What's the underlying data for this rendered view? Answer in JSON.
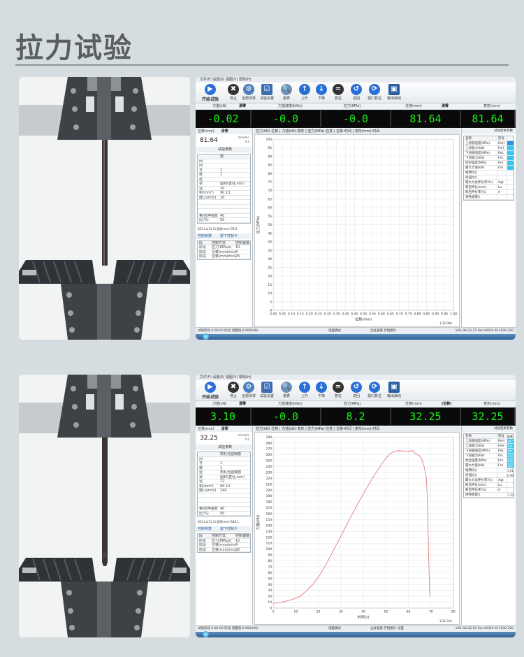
{
  "page_title": "拉力试验",
  "screens": [
    {
      "menubar": "文件(F)  设置(S)  视图(V)  帮助(H)",
      "toolbar": {
        "start": "开始试验",
        "stop": "停止",
        "clear": "全部清零",
        "settings": "试验设置",
        "report": "报表",
        "up": "上升",
        "down": "下降",
        "stop2": "复位",
        "return": "返回",
        "reset_view": "视口复位",
        "output": "输出曲线"
      },
      "value_headers": {
        "force": "力值(kN)",
        "clear": "清零",
        "force_rate": "力值速度(kN/s)",
        "stress": "应力(MPa)",
        "disp": "位移(mm)",
        "clear2": "清零",
        "deform": "变形(mm)"
      },
      "values": [
        "-0.02",
        "-0.0",
        "-0.0",
        "81.64",
        "81.64"
      ],
      "left": {
        "disp_label": "位移(mm)",
        "clear": "清零",
        "big_value": "81.64",
        "unit": "mm/min",
        "unit_value": "0.0",
        "params_title": "试验参数",
        "param_col": "值",
        "rows": [
          "间",
          "间",
          "号",
          "数",
          "型",
          "状",
          "径",
          "积(mm²)",
          "度Lo(mm)",
          "",
          "",
          "",
          "格/拉伸强度",
          "比(%)"
        ],
        "values": [
          "",
          "",
          "1",
          "1",
          "",
          "圆材(直径,mm)",
          "10",
          "90.13",
          "10",
          "",
          "",
          "",
          "40",
          "50"
        ],
        "formula": ".653  Lo(11.3)   面积(mm²)78.5",
        "control_title": "控制参数",
        "cancel": "放下控制卡",
        "ctrl_headers": [
          "段",
          "控制方式",
          "控制速度"
        ],
        "ctrl_rows": [
          [
            "阶段",
            "应力(MPa/s)",
            "10"
          ],
          [
            "阶段",
            "位移(mm/min)",
            "4"
          ],
          [
            "阶段",
            "位移(mm/min)",
            "25"
          ]
        ]
      },
      "tabs": "拉力(kN)-位移 | 力值(kN)-变形 | 应力(MPa)-应变 | 位移-时间 | 变形(mm)-时间",
      "chart_data": {
        "type": "line",
        "xlabel": "位移(mm)",
        "ylabel": "应力(MPa)",
        "xlim": [
          0,
          1
        ],
        "ylim": [
          0,
          100
        ],
        "x_ticks": [
          "0.00",
          "0.05",
          "0.10",
          "0.15",
          "0.20",
          "0.25",
          "0.30",
          "0.35",
          "0.40",
          "0.45",
          "0.50",
          "0.55",
          "0.60",
          "0.65",
          "0.70",
          "0.75",
          "0.80",
          "0.85",
          "0.90",
          "0.95",
          "1.00"
        ],
        "y_ticks": [
          "0",
          "5",
          "10",
          "15",
          "20",
          "25",
          "30",
          "35",
          "40",
          "45",
          "50",
          "55",
          "60",
          "65",
          "70",
          "75",
          "80",
          "85",
          "90",
          "95",
          "100"
        ],
        "grid": true,
        "series": [],
        "corner_label": "1:32.000"
      },
      "right": {
        "title": "试验结果参数",
        "headers": [
          "名称",
          "符号",
          ""
        ],
        "rows": [
          [
            "上屈服强度(MPa)",
            "ReH"
          ],
          [
            "上屈服力(kN)",
            "FeH"
          ],
          [
            "下屈服强度(MPa)",
            "ReL"
          ],
          [
            "下屈服力(kN)",
            "FeL"
          ],
          [
            "抗拉强度(MPa)",
            "Rm"
          ],
          [
            "最大力值(kN)",
            "Fm"
          ],
          [
            "缩颈比()",
            ""
          ],
          [
            "屈强比()",
            ""
          ],
          [
            "最大力总伸长率(%)",
            "Agt"
          ],
          [
            "断后伸长(mm)",
            "Lu"
          ],
          [
            "断后伸长率(%)",
            "A"
          ],
          [
            "弹性模量()",
            ""
          ]
        ],
        "values": [
          "",
          "",
          "",
          "",
          "",
          "",
          "",
          "",
          "",
          "",
          "",
          ""
        ]
      },
      "status": {
        "left": "试验阶段  0:00:00  阶段  测量值:0.000(kN)",
        "middle": "电脑模式",
        "mid2": "全屏查看  存档图片",
        "right": "V01.04.22.25 Rel V0024 M-3100.220"
      }
    },
    {
      "menubar": "文件(F)  设置(S)  视图(V)  帮助(H)",
      "toolbar": {
        "start": "开始试验",
        "stop": "停止",
        "clear": "全部清零",
        "settings": "试验设置",
        "report": "报表",
        "up": "上升",
        "down": "下降",
        "stop2": "复位",
        "return": "返回",
        "reset_view": "视口复位",
        "output": "输出曲线"
      },
      "value_headers": {
        "force": "力值(kN)",
        "clear": "清零",
        "force_rate": "力值速度(kN/s)",
        "stress": "应力(MPa)",
        "disp": "位移(mm)",
        "clear2": "(位移)",
        "deform": "变形(mm)"
      },
      "values": [
        "3.10",
        "-0.0",
        "8.2",
        "32.25",
        "32.25"
      ],
      "left": {
        "disp_label": "位移(mm)",
        "clear": "清零",
        "big_value": "32.25",
        "unit": "mm/min",
        "unit_value": "0.0",
        "params_title": "试验参数",
        "param_col": "热轧光圆钢筋",
        "rows": [
          "间",
          "号",
          "数",
          "型",
          "状",
          "径",
          "积(mm²)",
          "度Lo(mm)",
          "",
          "",
          "",
          "格/拉伸强度",
          "比(%)"
        ],
        "values": [
          "",
          "1",
          "1",
          "热轧光圆钢筋",
          "圆材(直径,mm)",
          "12",
          "90.13",
          "240",
          "",
          "",
          "",
          "40",
          "50"
        ],
        "formula": ".653  Lo(11.3)   面积(mm²)180.1",
        "control_title": "控制参数",
        "cancel": "放下控制卡",
        "ctrl_headers": [
          "段",
          "控制方式",
          "控制速度"
        ],
        "ctrl_rows": [
          [
            "阶段",
            "应力(MPa/s)",
            "10"
          ],
          [
            "阶段",
            "位移(mm/min)",
            "4"
          ],
          [
            "阶段",
            "位移(mm/min)",
            "25"
          ]
        ]
      },
      "tabs": "拉力(kN)-位移 | 力值(kN)-变形 | 应力(MPa)-应变 | 位移-时间 | 变形(mm)-时间",
      "chart_data": {
        "type": "line",
        "xlabel": "时间(s)",
        "ylabel": "力值(kN)",
        "xlim": [
          0,
          80
        ],
        "ylim": [
          0,
          290
        ],
        "x_ticks": [
          "0",
          "10",
          "20",
          "30",
          "40",
          "50",
          "60",
          "70",
          "80"
        ],
        "y_ticks": [
          "0",
          "10",
          "20",
          "30",
          "40",
          "50",
          "60",
          "70",
          "80",
          "90",
          "100",
          "110",
          "120",
          "130",
          "140",
          "150",
          "160",
          "170",
          "180",
          "190",
          "200",
          "210",
          "220",
          "230",
          "240",
          "250",
          "260",
          "270",
          "280",
          "290"
        ],
        "grid": true,
        "series": [
          {
            "color": "#e0706f",
            "x": [
              0,
              4,
              8,
              12,
              15,
              18,
              21,
              24,
              27,
              30,
              33,
              36,
              39,
              42,
              45,
              48,
              50,
              52,
              54,
              56,
              58,
              60,
              62,
              63,
              64,
              65,
              66,
              67,
              68,
              68.5,
              69,
              69.5
            ],
            "y": [
              8,
              10,
              14,
              20,
              30,
              42,
              58,
              78,
              100,
              122,
              144,
              166,
              187,
              207,
              226,
              243,
              254,
              262,
              266,
              267,
              266,
              266,
              267,
              262,
              260,
              258,
              252,
              240,
              220,
              180,
              90,
              20
            ]
          }
        ],
        "corner_label": "1:32.314"
      },
      "right": {
        "title": "试验结果参数",
        "headers": [
          "名称",
          "符号",
          "结果"
        ],
        "rows": [
          [
            "上屈服强度(MPa)",
            "ReH"
          ],
          [
            "上屈服力(kN)",
            "FeH"
          ],
          [
            "下屈服强度(MPa)",
            "ReL"
          ],
          [
            "下屈服力(kN)",
            "FeL"
          ],
          [
            "抗拉强度(MPa)",
            "Rm"
          ],
          [
            "最大力值(kN)",
            "Fm"
          ],
          [
            "缩颈比()",
            ""
          ],
          [
            "屈强比()",
            ""
          ],
          [
            "最大力总伸长率(%)",
            "Agt"
          ],
          [
            "断后伸长(mm)",
            "Lu"
          ],
          [
            "断后伸长率(%)",
            "A"
          ],
          [
            "弹性模量()",
            ""
          ]
        ],
        "values": [
          "487",
          "261",
          "481",
          "258",
          "295",
          "267",
          "1.01",
          "0.99",
          "",
          "",
          "",
          "1.70"
        ]
      },
      "status": {
        "left": "试验阶段  0:00:00  阶段  测量值:0.000(kN)",
        "middle": "电脑模式",
        "mid2": "全屏查看  存档图片  设置",
        "right": "V01.04.22.25 Rel V0024 M-3100.220"
      }
    }
  ]
}
